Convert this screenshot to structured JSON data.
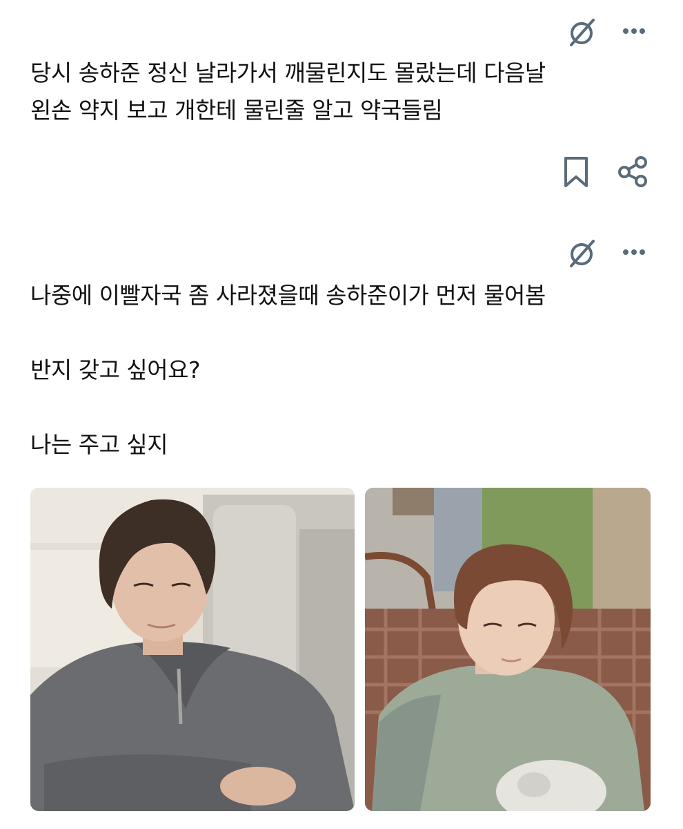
{
  "posts": [
    {
      "lines": [
        "당시 송하준 정신 날라가서 깨물린지도 몰랐는데 다음날",
        "왼손 약지 보고  개한테 물린줄 알고 약국들림"
      ]
    },
    {
      "lines": [
        "나중에 이빨자국 좀 사라졌을때 송하준이가 먼저 물어봄",
        "반지 갖고 싶어요?",
        "나는 주고 싶지"
      ]
    }
  ],
  "icons": {
    "translate": "slashed-circle-icon",
    "more": "more-dots-icon",
    "bookmark": "bookmark-icon",
    "share": "share-icon"
  },
  "colors": {
    "text": "#111111",
    "icon": "#5a6b7b",
    "background": "#ffffff"
  }
}
